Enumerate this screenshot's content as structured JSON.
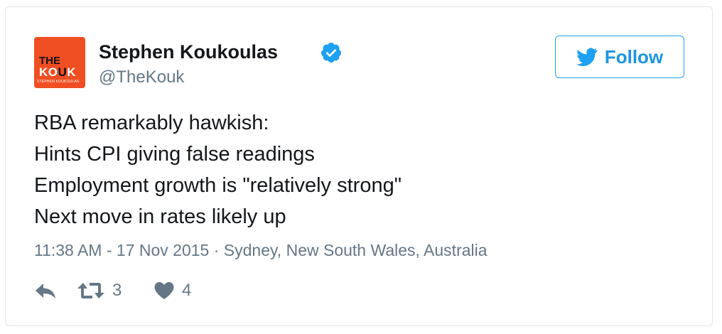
{
  "tweet": {
    "avatar": {
      "line1": "THE",
      "line2_a": "KO",
      "line2_b": "U",
      "line2_c": "K",
      "line3": "STEPHEN KOUKOULAS"
    },
    "author_name": "Stephen Koukoulas",
    "handle": "@TheKouk",
    "verified": true,
    "follow_label": "Follow",
    "text_lines": [
      "RBA remarkably hawkish:",
      "Hints CPI giving false readings",
      "Employment growth is \"relatively strong\"",
      "Next move in rates likely up"
    ],
    "timestamp": "11:38 AM - 17 Nov 2015",
    "separator": "·",
    "location": "Sydney, New South Wales, Australia",
    "retweet_count": "3",
    "like_count": "4"
  },
  "colors": {
    "accent": "#1da1f2",
    "verified": "#1da1f2",
    "muted": "#657786",
    "text": "#14171a",
    "border": "#e1e8ed",
    "avatar_bg": "#f04e23"
  },
  "icons": [
    "verified-badge-icon",
    "twitter-bird-icon",
    "reply-icon",
    "retweet-icon",
    "heart-icon"
  ]
}
